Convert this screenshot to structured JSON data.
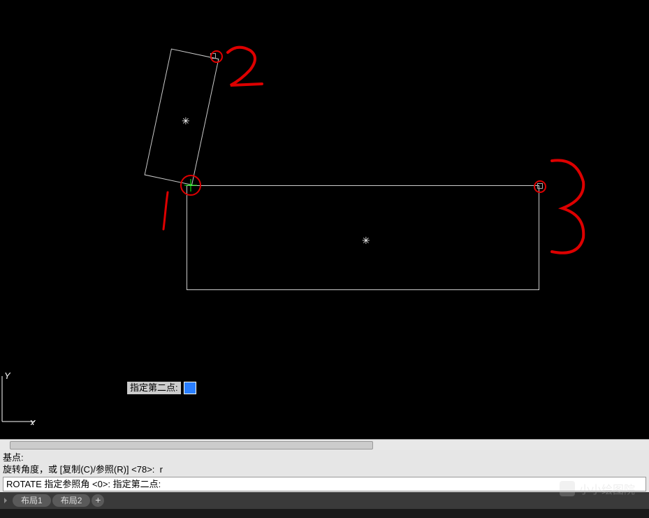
{
  "tooltip": {
    "label": "指定第二点:"
  },
  "command": {
    "line1": "基点:",
    "line2": "旋转角度，或 [复制(C)/参照(R)] <78>:  r",
    "line3": "ROTATE 指定参照角 <0>:  指定第二点:"
  },
  "tabs": {
    "tab1": "布局1",
    "tab2": "布局2",
    "add": "+"
  },
  "ucs": {
    "y": "Y",
    "x": "X"
  },
  "annotations": {
    "mark1": "1",
    "mark2": "2",
    "mark3": "3"
  },
  "watermark": {
    "text": "小小绘图院"
  }
}
